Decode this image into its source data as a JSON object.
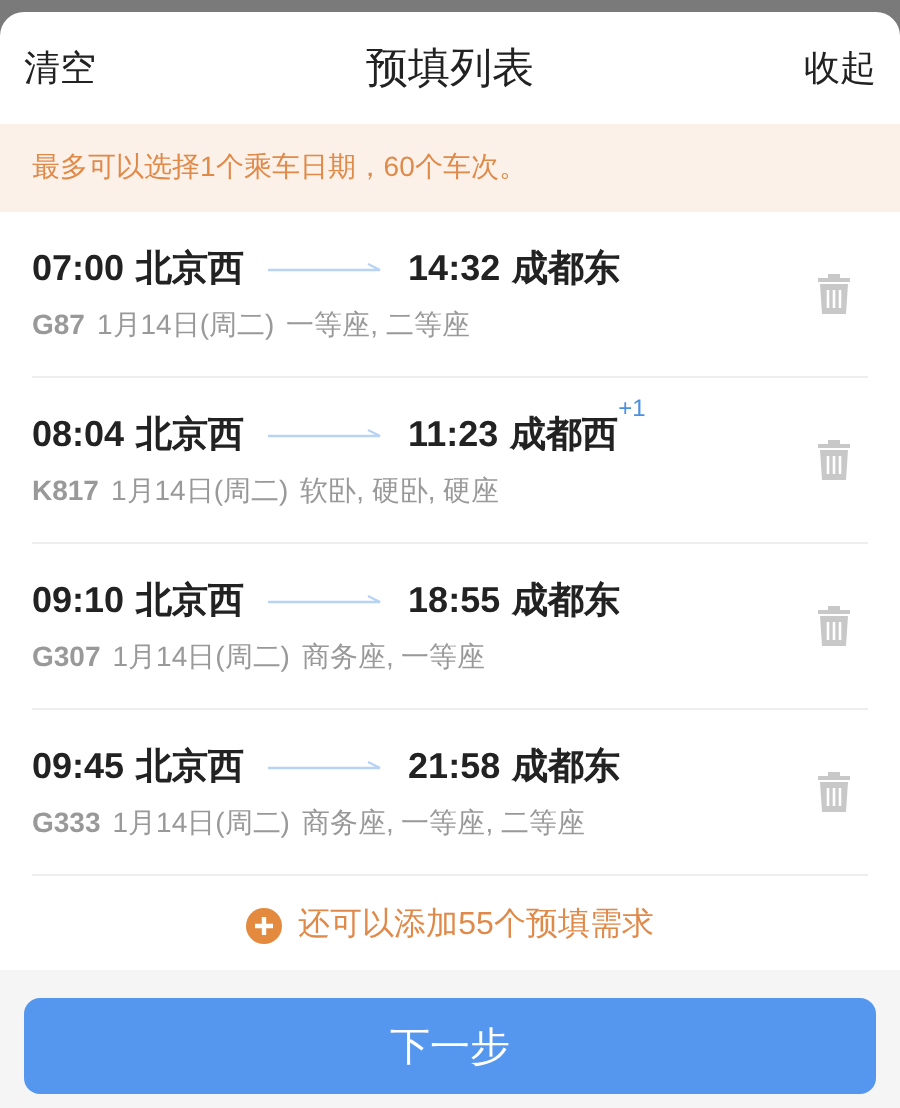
{
  "header": {
    "left_action": "清空",
    "title": "预填列表",
    "right_action": "收起"
  },
  "notice": "最多可以选择1个乘车日期，60个车次。",
  "trips": [
    {
      "depart_time": "07:00",
      "from": "北京西",
      "arrive_time": "14:32",
      "to": "成都东",
      "train": "G87",
      "date": "1月14日(周二)",
      "seats": "一等座, 二等座"
    },
    {
      "depart_time": "08:04",
      "from": "北京西",
      "arrive_time": "11:23",
      "to": "成都西",
      "day_offset": "+1",
      "train": "K817",
      "date": "1月14日(周二)",
      "seats": "软卧, 硬卧, 硬座"
    },
    {
      "depart_time": "09:10",
      "from": "北京西",
      "arrive_time": "18:55",
      "to": "成都东",
      "train": "G307",
      "date": "1月14日(周二)",
      "seats": "商务座, 一等座"
    },
    {
      "depart_time": "09:45",
      "from": "北京西",
      "arrive_time": "21:58",
      "to": "成都东",
      "train": "G333",
      "date": "1月14日(周二)",
      "seats": "商务座, 一等座, 二等座"
    }
  ],
  "add_more": "还可以添加55个预填需求",
  "next_button": "下一步"
}
